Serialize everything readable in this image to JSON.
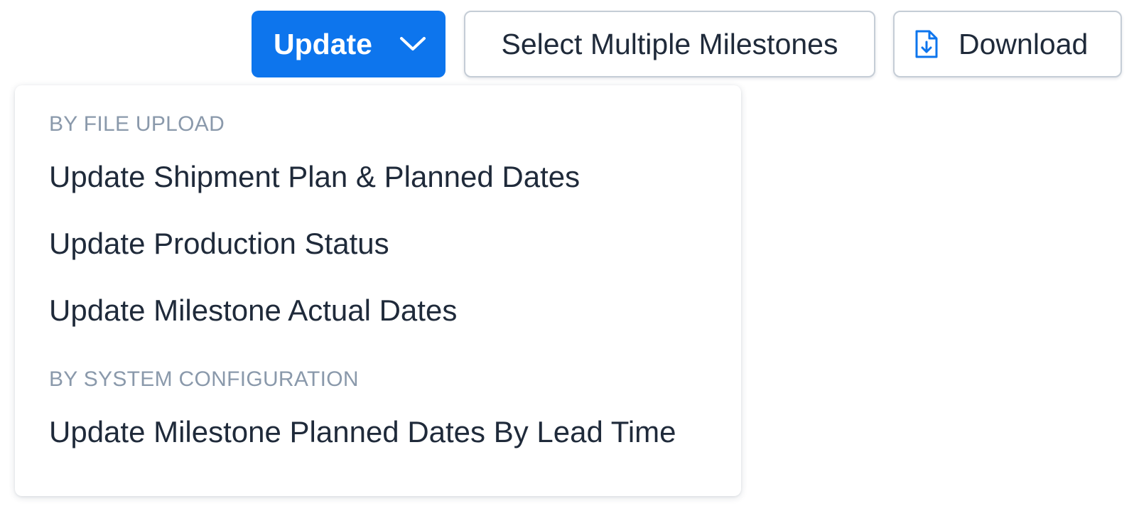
{
  "toolbar": {
    "update_label": "Update",
    "select_multiple_label": "Select Multiple Milestones",
    "download_label": "Download"
  },
  "update_menu": {
    "sections": [
      {
        "header": "BY FILE UPLOAD",
        "items": [
          "Update Shipment Plan & Planned Dates",
          "Update Production Status",
          "Update Milestone Actual Dates"
        ]
      },
      {
        "header": "BY SYSTEM CONFIGURATION",
        "items": [
          "Update Milestone Planned Dates By Lead Time"
        ]
      }
    ]
  },
  "icons": {
    "update_dropdown": "chevron-down-icon",
    "download": "file-download-icon"
  },
  "colors": {
    "primary": "#0d75ed",
    "text": "#1f2a3a",
    "section_header": "#8a99ab",
    "border": "#c5cdd6"
  }
}
